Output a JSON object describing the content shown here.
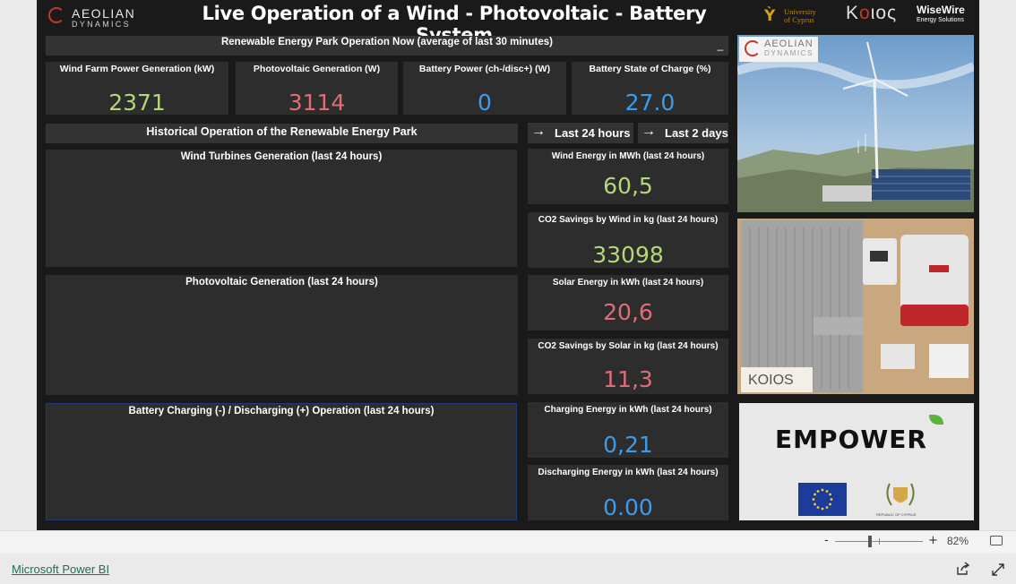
{
  "header": {
    "title": "Live Operation of a Wind - Photovoltaic - Battery System",
    "logos": {
      "aeolian_line1": "AEOLIAN",
      "aeolian_line2": "DYNAMICS",
      "ucy_line1": "University",
      "ucy_line2": "of Cyprus",
      "koios": "KOIOS",
      "wisewire_line1": "WiseWire",
      "wisewire_line2": "Energy Solutions"
    }
  },
  "now_section": {
    "title": "Renewable Energy Park Operation Now (average of last 30 minutes)",
    "cards": [
      {
        "label": "Wind Farm Power Generation (kW)",
        "value": "2371",
        "color": "#b5d67a"
      },
      {
        "label": "Photovoltaic Generation (W)",
        "value": "3114",
        "color": "#e06c75"
      },
      {
        "label": "Battery Power (ch-/disc+) (W)",
        "value": "0",
        "color": "#3d9be9"
      },
      {
        "label": "Battery State of Charge (%)",
        "value": "27.0",
        "color": "#3d9be9"
      }
    ]
  },
  "history_section": {
    "title": "Historical Operation of the Renewable Energy Park",
    "buttons": [
      {
        "label": "Last 24 hours",
        "icon": "arrow-right-icon"
      },
      {
        "label": "Last 2 days",
        "icon": "arrow-right-icon"
      }
    ],
    "charts": [
      {
        "title": "Wind Turbines Generation (last 24 hours)"
      },
      {
        "title": "Photovoltaic Generation (last 24 hours)"
      },
      {
        "title": "Battery Charging (-) / Discharging (+) Operation (last 24 hours)"
      }
    ],
    "kpis": [
      {
        "label": "Wind Energy in MWh (last 24 hours)",
        "value": "60,5",
        "color": "#b5d67a"
      },
      {
        "label": "CO2 Savings by Wind in kg (last 24 hours)",
        "value": "33098",
        "color": "#b5d67a"
      },
      {
        "label": "Solar Energy in kWh (last 24 hours)",
        "value": "20,6",
        "color": "#e06c75"
      },
      {
        "label": "CO2 Savings by Solar in kg (last 24 hours)",
        "value": "11,3",
        "color": "#e06c75"
      },
      {
        "label": "Charging Energy in kWh (last 24 hours)",
        "value": "0,21",
        "color": "#3d9be9"
      },
      {
        "label": "Discharging Energy in kWh (last 24 hours)",
        "value": "0.00",
        "color": "#3d9be9"
      }
    ]
  },
  "images": {
    "wind_photo_logo_1": "AEOLIAN",
    "wind_photo_logo_2": "DYNAMICS",
    "battery_photo_logo": "KOIOS",
    "empower_text": "EMPOWER",
    "empower_caption": "REPUBLIC OF CYPRUS"
  },
  "statusbar": {
    "zoom_minus": "-",
    "zoom_plus": "+",
    "zoom_value": "82%",
    "zoom_fraction": 0.82
  },
  "footer": {
    "link": "Microsoft Power BI"
  }
}
